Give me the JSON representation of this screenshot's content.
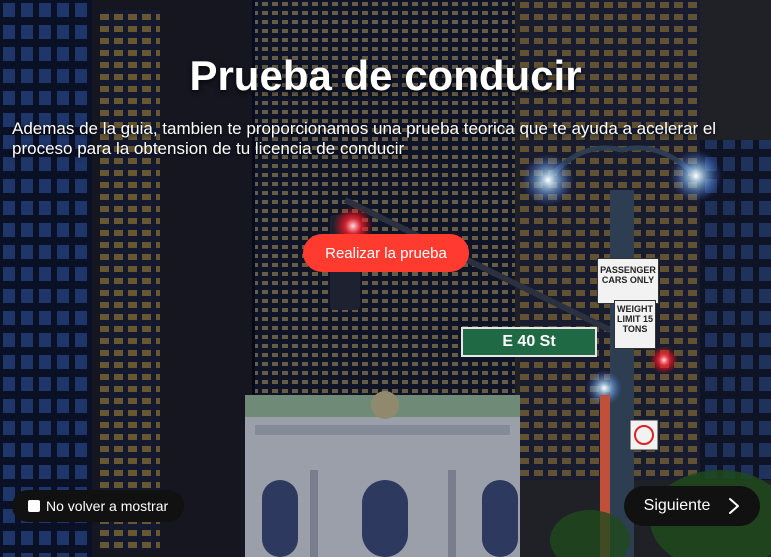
{
  "hero": {
    "title": "Prueba de conducir",
    "description": "Ademas de la guia, tambien te proporcionamos una prueba teorica que te ayuda a acelerar el proceso para la obtension de tu licencia de conducir",
    "cta_label": "Realizar la prueba"
  },
  "footer": {
    "dont_show_label": "No volver a mostrar",
    "next_label": "Siguiente"
  },
  "scene": {
    "street_sign": "E 40 St",
    "passenger_sign": "PASSENGER CARS ONLY",
    "weight_sign": "WEIGHT LIMIT 15 TONS"
  },
  "colors": {
    "accent": "#ff3b30",
    "pill_bg": "#111111"
  }
}
